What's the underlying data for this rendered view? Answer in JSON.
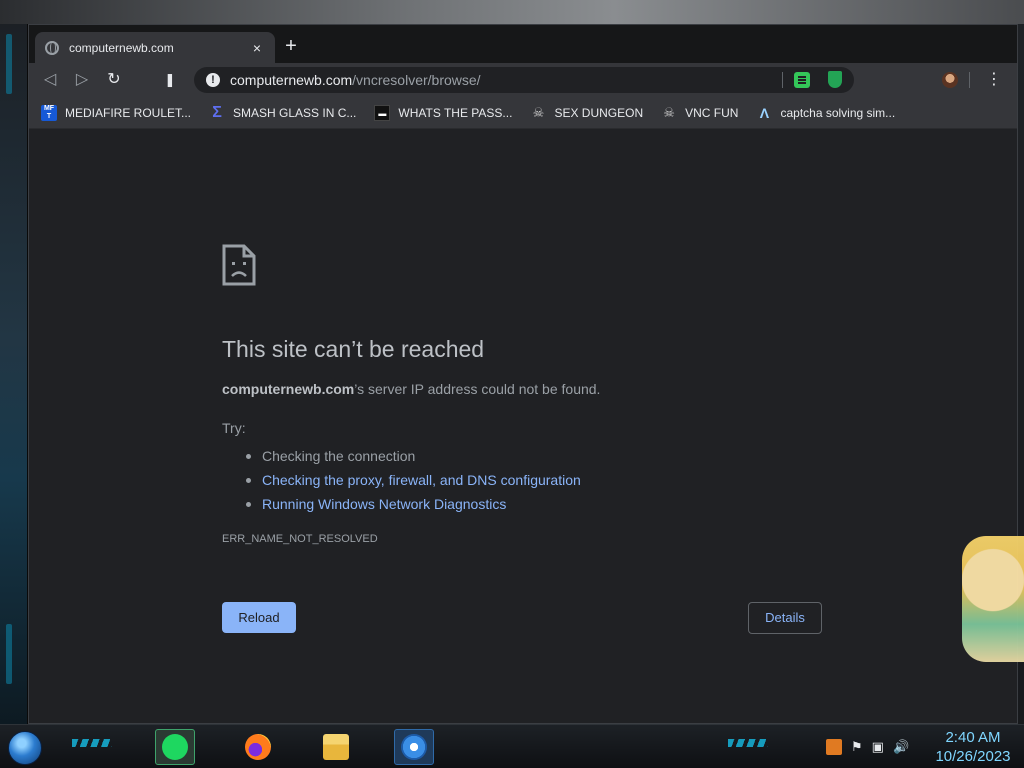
{
  "browser": {
    "tab": {
      "title": "computernewb.com",
      "close": "×"
    },
    "new_tab": "+",
    "nav": {
      "back": "◁",
      "forward": "▷",
      "reload": "↻",
      "bookmark": "❚"
    },
    "address": {
      "info": "!",
      "domain": "computernewb.com",
      "path": "/vncresolver/browse/"
    },
    "menu": "⋮",
    "bookmarks": [
      {
        "icon": "MF T",
        "label": "MEDIAFIRE ROULET..."
      },
      {
        "icon": "Σ",
        "label": "SMASH GLASS IN C..."
      },
      {
        "icon": "▬",
        "label": "WHATS THE PASS..."
      },
      {
        "icon": "☠",
        "label": "SEX DUNGEON"
      },
      {
        "icon": "☠",
        "label": "VNC FUN"
      },
      {
        "icon": "Λ",
        "label": "captcha solving sim..."
      }
    ]
  },
  "error_page": {
    "title": "This site can’t be reached",
    "subtitle_host": "computernewb.com",
    "subtitle_rest": "’s server IP address could not be found.",
    "try": "Try:",
    "tips": [
      "Checking the connection",
      "Checking the proxy, firewall, and DNS configuration",
      "Running Windows Network Diagnostics"
    ],
    "code": "ERR_NAME_NOT_RESOLVED",
    "reload_label": "Reload",
    "details_label": "Details"
  },
  "taskbar": {
    "time": "2:40 AM",
    "date": "10/26/2023",
    "tray": {
      "flag": "⚑",
      "network": "▣",
      "volume": "🔊"
    }
  },
  "colors": {
    "accent_blue": "#8ab4f8",
    "page_bg": "#202124",
    "toolbar_bg": "#35363a",
    "clock": "#7fd6ff"
  }
}
